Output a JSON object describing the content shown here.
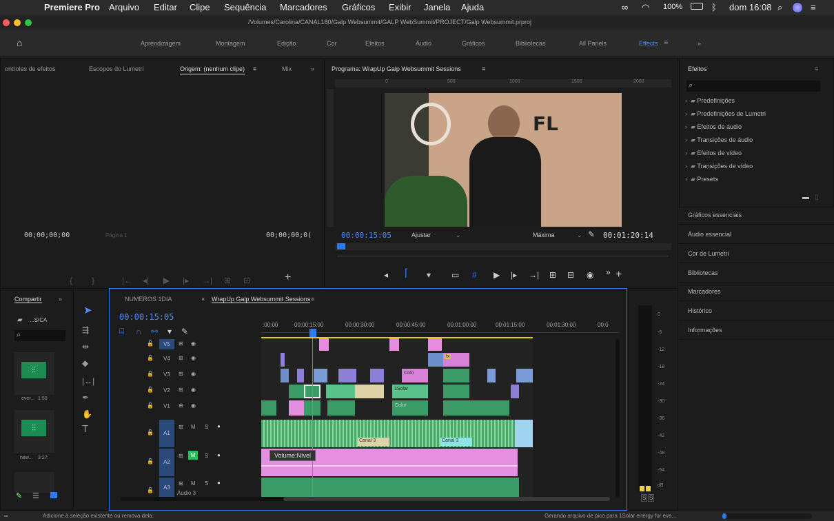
{
  "menubar": {
    "apple": "",
    "app": "Premiere Pro",
    "items": [
      "Arquivo",
      "Editar",
      "Clipe",
      "Sequência",
      "Marcadores",
      "Gráficos",
      "Exibir",
      "Janela",
      "Ajuda"
    ],
    "battery": "100%",
    "clock": "dom 16:08"
  },
  "title_path": "/Volumes/Carolina/CANAL180/Galp Websummit/GALP WebSummit/PROJECT/Galp Websummit.prproj",
  "workspaces": [
    "Aprendizagem",
    "Montagem",
    "Edição",
    "Cor",
    "Efeitos",
    "Áudio",
    "Gráficos",
    "Bibliotecas",
    "All Panels",
    "Effects",
    "»"
  ],
  "active_workspace": "Effects",
  "source_panel": {
    "tabs": [
      "ontroles de efeitos",
      "Escopos do Lumetri",
      "Origem: (nenhum clipe)",
      "Mix"
    ],
    "timecode_left": "00;00;00;00",
    "page_label": "Página 1",
    "timecode_right": "00;00;00;0("
  },
  "program_panel": {
    "title": "Programa: WrapUp Galp Websummit Sessions",
    "ruler": [
      "0",
      "500",
      "1000",
      "1500",
      "2000"
    ],
    "current_time": "00:00:15:05",
    "fit_label": "Ajustar",
    "quality_label": "Máxima",
    "duration": "00:01:20:14"
  },
  "effects_panel": {
    "title": "Efeitos",
    "search_placeholder": "",
    "items": [
      "Predefinições",
      "Predefinições de Lumetri",
      "Efeitos de áudio",
      "Transições de áudio",
      "Efeitos de vídeo",
      "Transições de vídeo",
      "Presets"
    ]
  },
  "right_panels": [
    "Gráficos essenciais",
    "Áudio essencial",
    "Cor de Lumetri",
    "Bibliotecas",
    "Marcadores",
    "Histórico",
    "Informações"
  ],
  "project_panel": {
    "tab": "Compartir",
    "bin": "...SICA",
    "items": [
      {
        "name": "ever...",
        "duration": "1:50"
      },
      {
        "name": "new...",
        "duration": "3:27:"
      }
    ]
  },
  "timeline": {
    "tabs": [
      "NUMEROS 1DIA",
      "WrapUp Galp Websummit Sessions"
    ],
    "current_time": "00:00:15:05",
    "ruler": [
      ":00:00",
      "00:00:15:00",
      "00:00:30:00",
      "00:00:45:00",
      "00:01:00:00",
      "00:01:15:00",
      "00:01:30:00",
      "00:0"
    ],
    "video_tracks": [
      "V5",
      "V4",
      "V3",
      "V2",
      "V1"
    ],
    "audio_tracks": [
      "A1",
      "A2",
      "A3"
    ],
    "audio_track_names": {
      "A3": "Áudio 3"
    },
    "tooltip": "Volume:Nível",
    "clip_labels": [
      "Colo",
      "1Solar",
      "Color",
      "Canal 3",
      "Canal 3",
      "fx"
    ]
  },
  "meter": {
    "labels": [
      "0",
      "-6",
      "-12",
      "-18",
      "-24",
      "-30",
      "-36",
      "-42",
      "-48",
      "-54",
      "dB"
    ],
    "solo": [
      "S",
      "S"
    ]
  },
  "status": {
    "left": "Adicione à seleção existente ou remova dela.",
    "right": "Gerando arquivo de pico para 1Solar energy for eve..."
  },
  "colors": {
    "accent": "#2b7bf2",
    "pink_clip": "#e58ee0",
    "green_clip": "#3a9b66",
    "violet_clip": "#8c7fd6"
  }
}
